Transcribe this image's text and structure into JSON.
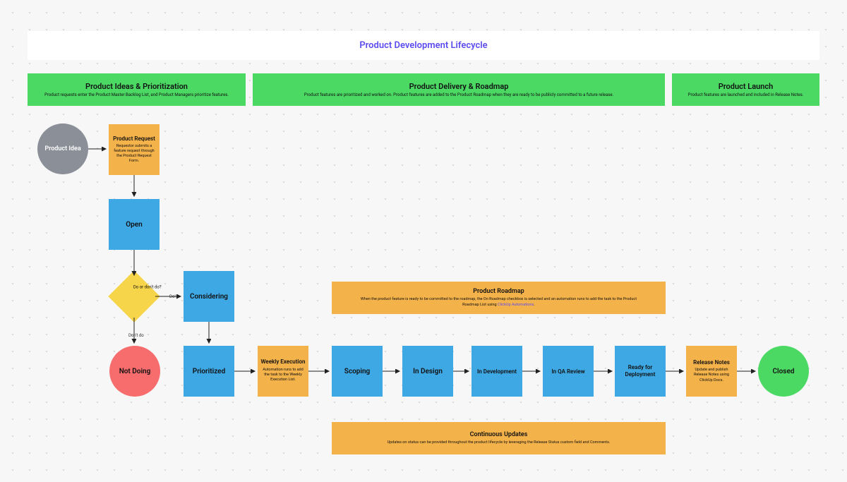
{
  "title": "Product Development Lifecycle",
  "phases": {
    "ideas": {
      "title": "Product Ideas & Prioritization",
      "sub": "Product requests enter the Product Master Backlog List, and Product Managers prioritize features."
    },
    "delivery": {
      "title": "Product Delivery & Roadmap",
      "sub": "Product features are prioritized and worked on. Product features are added to the Product Roadmap when they are ready to be publicly committed to a future release."
    },
    "launch": {
      "title": "Product Launch",
      "sub": "Product features are launched and included in Release Notes."
    }
  },
  "nodes": {
    "idea": "Product Idea",
    "request": {
      "title": "Product Request",
      "sub": "Requestor submits a feature request through the Product Request Form."
    },
    "open": "Open",
    "decision": "Do or don't do?",
    "considering": "Considering",
    "notdoing": "Not Doing",
    "prioritized": "Prioritized",
    "weekly": {
      "title": "Weekly Execution",
      "sub": "Automation runs to add the task to the Weekly Execution List."
    },
    "scoping": "Scoping",
    "indesign": "In Design",
    "indev": "In Development",
    "inqa": "In QA Review",
    "ready": "Ready for Deployment",
    "relnotes": {
      "title": "Release Notes",
      "sub": "Update and publish Release Notes using ClickUp Docs."
    },
    "closed": "Closed"
  },
  "roadmap": {
    "title": "Product Roadmap",
    "sub_prefix": "When the product feature is ready to be committed to the roadmap, the On Roadmap checkbox is selected and an automation runs to add the task to the Product Roadmap List using ",
    "sub_link": "ClickUp Automations"
  },
  "continuous": {
    "title": "Continuous Updates",
    "sub": "Updates on status can be provided throughout the product lifecycle by leveraging the Release Status custom field and Comments."
  },
  "edge_labels": {
    "do": "Do!",
    "dont": "Don't do"
  },
  "colors": {
    "grey": "#8a8f98",
    "orange": "#f4b24a",
    "blue": "#3ea8e5",
    "yellow": "#f7d54a",
    "red": "#f76c6c",
    "green": "#4bd964"
  }
}
